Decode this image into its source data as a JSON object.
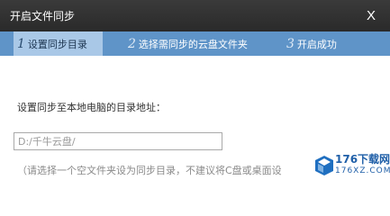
{
  "window": {
    "title": "开启文件同步",
    "close_label": "X"
  },
  "steps": [
    {
      "number": "1",
      "label": "设置同步目录",
      "active": true
    },
    {
      "number": "2",
      "label": "选择需同步的云盘文件夹",
      "active": false
    },
    {
      "number": "3",
      "label": "开启成功",
      "active": false
    }
  ],
  "form": {
    "label": "设置同步至本地电脑的目录地址：",
    "path_value": "D:/千牛云盘/",
    "hint": "（请选择一个空文件夹设为同步目录，不建议将C盘或桌面设"
  },
  "watermark": {
    "brand": "176下载网",
    "site": "176XZ.COM"
  },
  "colors": {
    "titlebar": "#2f2f2f",
    "stepbar": "#5f94c8",
    "step_active": "#a9c8e7"
  }
}
